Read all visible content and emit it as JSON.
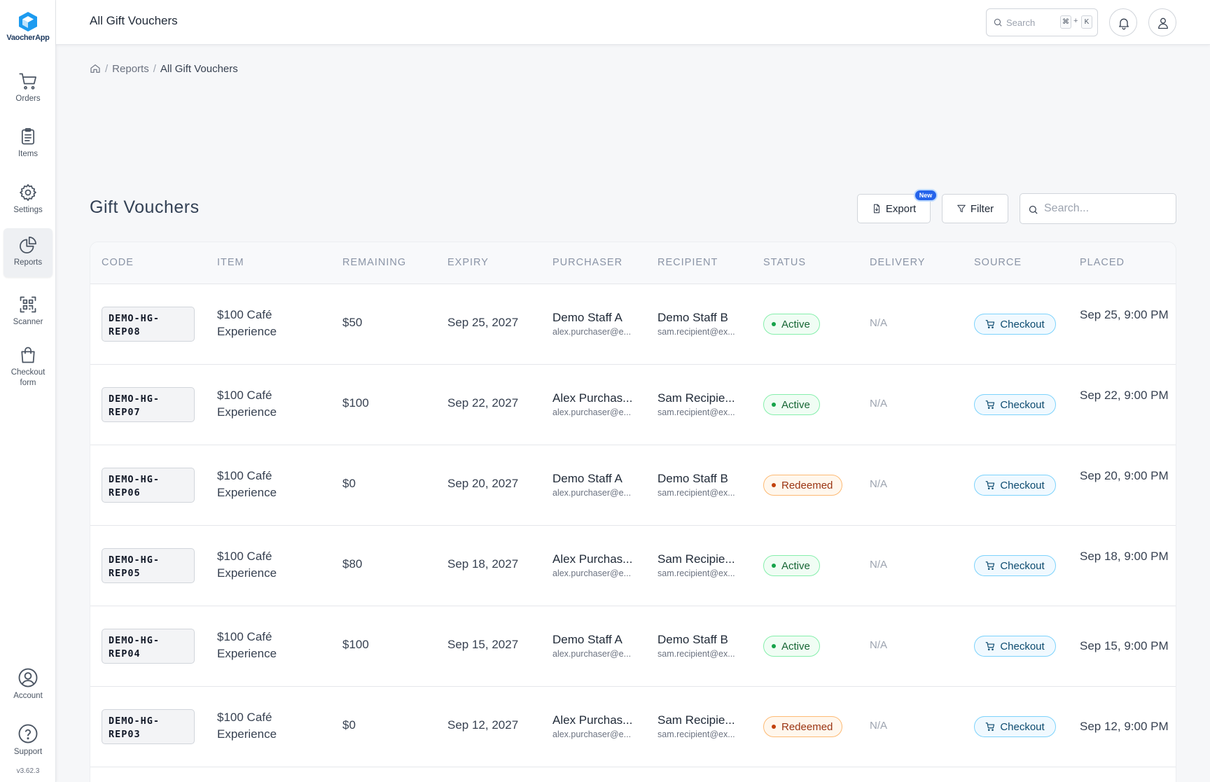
{
  "app": {
    "name": "VaocherApp",
    "version": "v3.62.3"
  },
  "sidebar": {
    "items": [
      {
        "label": "Orders",
        "icon": "cart-icon"
      },
      {
        "label": "Items",
        "icon": "clipboard-icon"
      },
      {
        "label": "Settings",
        "icon": "gear-icon"
      },
      {
        "label": "Reports",
        "icon": "pie-chart-icon",
        "active": true
      },
      {
        "label": "Scanner",
        "icon": "qr-scan-icon"
      },
      {
        "label": "Checkout form",
        "icon": "shopping-bag-icon"
      }
    ],
    "bottom": [
      {
        "label": "Account",
        "icon": "user-circle-icon"
      },
      {
        "label": "Support",
        "icon": "help-circle-icon"
      }
    ]
  },
  "header": {
    "title": "All Gift Vouchers",
    "search_placeholder": "Search",
    "shortcut": [
      "⌘",
      "+",
      "K"
    ]
  },
  "breadcrumb": {
    "reports": "Reports",
    "current": "All Gift Vouchers",
    "sep": "/"
  },
  "section": {
    "title": "Gift Vouchers",
    "export_label": "Export",
    "new_badge": "New",
    "filter_label": "Filter",
    "search_placeholder": "Search..."
  },
  "table": {
    "columns": [
      "CODE",
      "ITEM",
      "REMAINING",
      "EXPIRY",
      "PURCHASER",
      "RECIPIENT",
      "STATUS",
      "DELIVERY",
      "SOURCE",
      "PLACED"
    ],
    "rows": [
      {
        "code": "DEMO-HG-\nREP08",
        "item": "$100 Café Experience",
        "remaining": "$50",
        "expiry": "Sep 25, 2027",
        "purchaser": "Demo Staff A",
        "purchaser_email": "alex.purchaser@e...",
        "recipient": "Demo Staff B",
        "recipient_email": "sam.recipient@ex...",
        "status": "Active",
        "delivery": "N/A",
        "source": "Checkout",
        "placed": "Sep 25, 9:00 PM"
      },
      {
        "code": "DEMO-HG-\nREP07",
        "item": "$100 Café Experience",
        "remaining": "$100",
        "expiry": "Sep 22, 2027",
        "purchaser": "Alex Purchas...",
        "purchaser_email": "alex.purchaser@e...",
        "recipient": "Sam Recipie...",
        "recipient_email": "sam.recipient@ex...",
        "status": "Active",
        "delivery": "N/A",
        "source": "Checkout",
        "placed": "Sep 22, 9:00 PM"
      },
      {
        "code": "DEMO-HG-\nREP06",
        "item": "$100 Café Experience",
        "remaining": "$0",
        "expiry": "Sep 20, 2027",
        "purchaser": "Demo Staff A",
        "purchaser_email": "alex.purchaser@e...",
        "recipient": "Demo Staff B",
        "recipient_email": "sam.recipient@ex...",
        "status": "Redeemed",
        "delivery": "N/A",
        "source": "Checkout",
        "placed": "Sep 20, 9:00 PM"
      },
      {
        "code": "DEMO-HG-\nREP05",
        "item": "$100 Café Experience",
        "remaining": "$80",
        "expiry": "Sep 18, 2027",
        "purchaser": "Alex Purchas...",
        "purchaser_email": "alex.purchaser@e...",
        "recipient": "Sam Recipie...",
        "recipient_email": "sam.recipient@ex...",
        "status": "Active",
        "delivery": "N/A",
        "source": "Checkout",
        "placed": "Sep 18, 9:00 PM"
      },
      {
        "code": "DEMO-HG-\nREP04",
        "item": "$100 Café Experience",
        "remaining": "$100",
        "expiry": "Sep 15, 2027",
        "purchaser": "Demo Staff A",
        "purchaser_email": "alex.purchaser@e...",
        "recipient": "Demo Staff B",
        "recipient_email": "sam.recipient@ex...",
        "status": "Active",
        "delivery": "N/A",
        "source": "Checkout",
        "placed": "Sep 15, 9:00 PM"
      },
      {
        "code": "DEMO-HG-\nREP03",
        "item": "$100 Café Experience",
        "remaining": "$0",
        "expiry": "Sep 12, 2027",
        "purchaser": "Alex Purchas...",
        "purchaser_email": "alex.purchaser@e...",
        "recipient": "Sam Recipie...",
        "recipient_email": "sam.recipient@ex...",
        "status": "Redeemed",
        "delivery": "N/A",
        "source": "Checkout",
        "placed": "Sep 12, 9:00 PM"
      }
    ]
  },
  "colors": {
    "accent": "#2563eb",
    "active": "#16a34a",
    "redeemed": "#c2410c",
    "source": "#0c4a6e"
  }
}
